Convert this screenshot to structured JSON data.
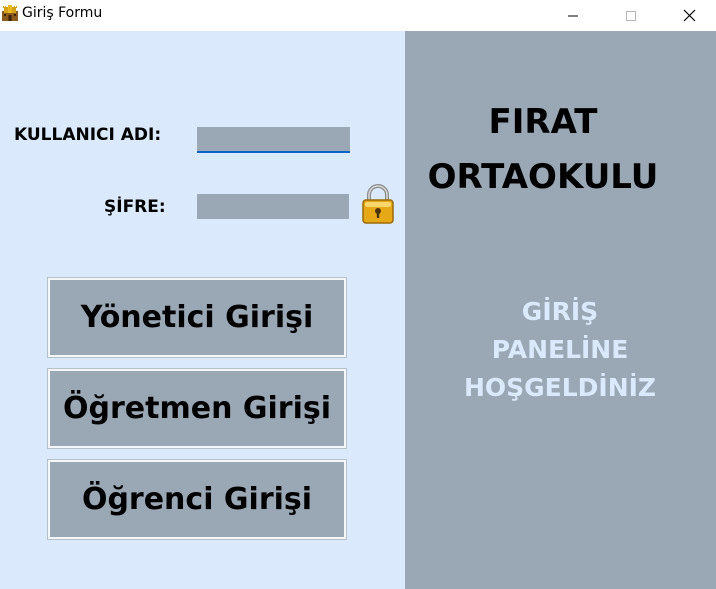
{
  "window": {
    "title": "Giriş Formu",
    "icons": {
      "app": "castle-icon",
      "minimize": "minimize-icon",
      "maximize": "maximize-icon",
      "close": "close-icon"
    }
  },
  "form": {
    "username_label": "KULLANICI ADI:",
    "username_value": "",
    "password_label": "ŞİFRE:",
    "password_value": "",
    "lock_icon": "lock-icon"
  },
  "buttons": {
    "admin_login": "Yönetici Girişi",
    "teacher_login": "Öğretmen Girişi",
    "student_login": "Öğrenci Girişi"
  },
  "side_panel": {
    "school_line1": "FIRAT",
    "school_line2": "ORTAOKULU",
    "welcome_line1": "GİRİŞ",
    "welcome_line2": "PANELİNE",
    "welcome_line3": "HOŞGELDİNİZ"
  },
  "colors": {
    "left_bg": "#dae9fb",
    "right_bg": "#9aa7b4",
    "welcome_text": "#dae9fb",
    "input_focus": "#0a64c8"
  }
}
